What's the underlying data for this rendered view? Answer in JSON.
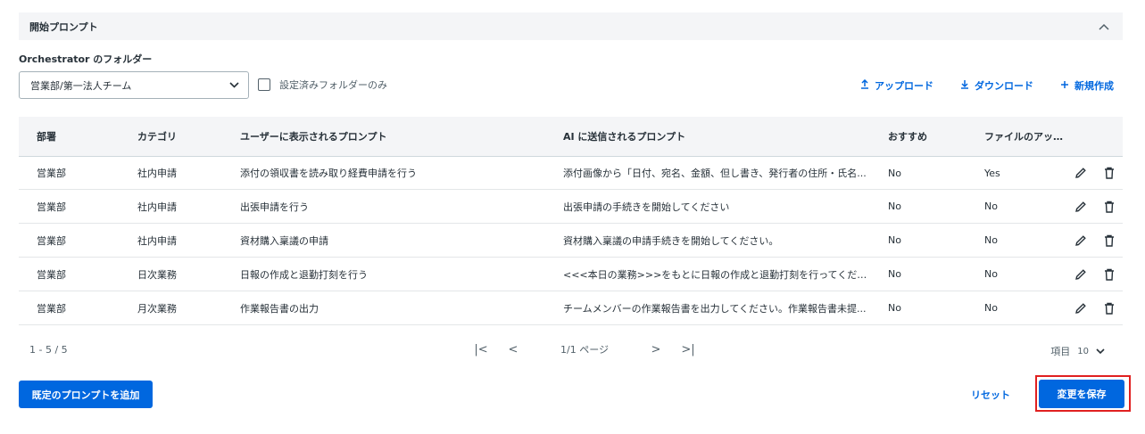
{
  "section": {
    "title": "開始プロンプト"
  },
  "folder": {
    "label": "Orchestrator のフォルダー",
    "selected": "営業部/第一法人チーム",
    "only_configured_label": "設定済みフォルダーのみ"
  },
  "toolbar": {
    "upload": "アップロード",
    "download": "ダウンロード",
    "create": "新規作成"
  },
  "table": {
    "headers": [
      "部署",
      "カテゴリ",
      "ユーザーに表示されるプロンプト",
      "AI に送信されるプロンプト",
      "おすすめ",
      "ファイルのアップロ..."
    ],
    "rows": [
      [
        "営業部",
        "社内申請",
        "添付の領収書を読み取り経費申請を行う",
        "添付画像から「日付、宛名、金額、但し書き、発行者の住所・氏名...",
        "No",
        "Yes"
      ],
      [
        "営業部",
        "社内申請",
        "出張申請を行う",
        "出張申請の手続きを開始してください",
        "No",
        "No"
      ],
      [
        "営業部",
        "社内申請",
        "資材購入稟議の申請",
        "資材購入稟議の申請手続きを開始してください。",
        "No",
        "No"
      ],
      [
        "営業部",
        "日次業務",
        "日報の作成と退勤打刻を行う",
        "<<<本日の業務>>>をもとに日報の作成と退勤打刻を行ってください",
        "No",
        "No"
      ],
      [
        "営業部",
        "月次業務",
        "作業報告書の出力",
        "チームメンバーの作業報告書を出力してください。作業報告書未提...",
        "No",
        "No"
      ]
    ]
  },
  "pager": {
    "range": "1 - 5 / 5",
    "page": "1/1 ページ",
    "items_label": "項目",
    "page_size": "10"
  },
  "footer": {
    "add_default": "既定のプロンプトを追加",
    "reset": "リセット",
    "save": "変更を保存"
  },
  "colors": {
    "accent": "#0067df",
    "highlight": "#e02020"
  }
}
